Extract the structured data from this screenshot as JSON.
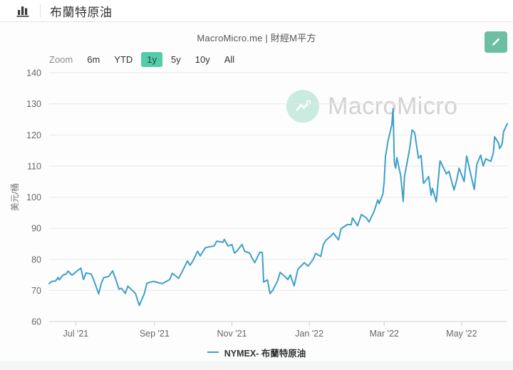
{
  "header": {
    "title": "布蘭特原油",
    "chart_icon": "bar-chart-icon"
  },
  "subheader": {
    "source": "MacroMicro.me | 財經M平方"
  },
  "toolbar": {
    "zoom_label": "Zoom",
    "ranges": [
      {
        "label": "6m",
        "active": false
      },
      {
        "label": "YTD",
        "active": false
      },
      {
        "label": "1y",
        "active": true
      },
      {
        "label": "5y",
        "active": false
      },
      {
        "label": "10y",
        "active": false
      },
      {
        "label": "All",
        "active": false
      }
    ]
  },
  "watermark": {
    "text": "MacroMicro"
  },
  "legend": {
    "series_label": "NYMEX- 布蘭特原油"
  },
  "colors": {
    "line": "#3fa0c8",
    "active_range_bg": "#54cba9",
    "edit_button_bg": "#6cbfa2",
    "grid": "#e8e8e8",
    "axis_line": "#d4d4d4",
    "tick": "#cccccc",
    "axis_label": "#666666",
    "watermark_circle": "#c9ebe0",
    "watermark_text": "#d2d2d2"
  },
  "chart_data": {
    "type": "line",
    "title": "布蘭特原油",
    "ylabel": "美元/桶",
    "ylim": [
      60,
      140
    ],
    "yticks": [
      60,
      70,
      80,
      90,
      100,
      110,
      120,
      130,
      140
    ],
    "grid": true,
    "legend_position": "bottom",
    "xticks": [
      {
        "date": "2021-07-01",
        "label": "Jul '21"
      },
      {
        "date": "2021-09-01",
        "label": "Sep '21"
      },
      {
        "date": "2021-11-01",
        "label": "Nov '21"
      },
      {
        "date": "2022-01-01",
        "label": "Jan '22"
      },
      {
        "date": "2022-03-01",
        "label": "Mar '22"
      },
      {
        "date": "2022-05-01",
        "label": "May '22"
      }
    ],
    "series": [
      {
        "name": "NYMEX- 布蘭特原油",
        "color": "#3fa0c8",
        "points": [
          [
            "2021-06-10",
            72.2
          ],
          [
            "2021-06-12",
            72.9
          ],
          [
            "2021-06-15",
            73.0
          ],
          [
            "2021-06-17",
            74.2
          ],
          [
            "2021-06-18",
            73.4
          ],
          [
            "2021-06-21",
            75.0
          ],
          [
            "2021-06-23",
            75.2
          ],
          [
            "2021-06-25",
            76.2
          ],
          [
            "2021-06-28",
            74.9
          ],
          [
            "2021-07-01",
            75.9
          ],
          [
            "2021-07-05",
            77.2
          ],
          [
            "2021-07-07",
            73.5
          ],
          [
            "2021-07-09",
            75.6
          ],
          [
            "2021-07-13",
            75.3
          ],
          [
            "2021-07-15",
            73.5
          ],
          [
            "2021-07-19",
            68.9
          ],
          [
            "2021-07-21",
            72.2
          ],
          [
            "2021-07-23",
            74.1
          ],
          [
            "2021-07-27",
            74.5
          ],
          [
            "2021-07-30",
            76.3
          ],
          [
            "2021-08-02",
            72.9
          ],
          [
            "2021-08-04",
            70.4
          ],
          [
            "2021-08-06",
            70.7
          ],
          [
            "2021-08-09",
            69.0
          ],
          [
            "2021-08-11",
            71.4
          ],
          [
            "2021-08-13",
            70.6
          ],
          [
            "2021-08-17",
            69.0
          ],
          [
            "2021-08-20",
            65.2
          ],
          [
            "2021-08-24",
            69.0
          ],
          [
            "2021-08-26",
            72.3
          ],
          [
            "2021-08-31",
            72.9
          ],
          [
            "2021-09-03",
            72.6
          ],
          [
            "2021-09-07",
            72.2
          ],
          [
            "2021-09-09",
            72.6
          ],
          [
            "2021-09-13",
            73.5
          ],
          [
            "2021-09-15",
            75.5
          ],
          [
            "2021-09-20",
            73.9
          ],
          [
            "2021-09-23",
            76.2
          ],
          [
            "2021-09-27",
            79.5
          ],
          [
            "2021-09-29",
            78.1
          ],
          [
            "2021-10-01",
            79.3
          ],
          [
            "2021-10-05",
            82.6
          ],
          [
            "2021-10-07",
            81.1
          ],
          [
            "2021-10-11",
            83.7
          ],
          [
            "2021-10-14",
            84.0
          ],
          [
            "2021-10-18",
            84.3
          ],
          [
            "2021-10-20",
            85.8
          ],
          [
            "2021-10-25",
            85.5
          ],
          [
            "2021-10-26",
            86.4
          ],
          [
            "2021-10-29",
            84.3
          ],
          [
            "2021-11-01",
            84.7
          ],
          [
            "2021-11-03",
            82.0
          ],
          [
            "2021-11-05",
            82.7
          ],
          [
            "2021-11-09",
            84.8
          ],
          [
            "2021-11-11",
            82.6
          ],
          [
            "2021-11-15",
            82.0
          ],
          [
            "2021-11-17",
            80.3
          ],
          [
            "2021-11-19",
            78.9
          ],
          [
            "2021-11-23",
            82.3
          ],
          [
            "2021-11-25",
            82.2
          ],
          [
            "2021-11-26",
            72.7
          ],
          [
            "2021-11-29",
            73.4
          ],
          [
            "2021-12-01",
            69.0
          ],
          [
            "2021-12-03",
            69.9
          ],
          [
            "2021-12-07",
            73.1
          ],
          [
            "2021-12-09",
            75.8
          ],
          [
            "2021-12-13",
            74.4
          ],
          [
            "2021-12-15",
            73.5
          ],
          [
            "2021-12-17",
            75.0
          ],
          [
            "2021-12-20",
            71.5
          ],
          [
            "2021-12-23",
            76.8
          ],
          [
            "2021-12-28",
            78.9
          ],
          [
            "2021-12-31",
            77.8
          ],
          [
            "2022-01-04",
            80.0
          ],
          [
            "2022-01-06",
            81.9
          ],
          [
            "2022-01-10",
            80.9
          ],
          [
            "2022-01-12",
            84.7
          ],
          [
            "2022-01-14",
            86.1
          ],
          [
            "2022-01-18",
            87.5
          ],
          [
            "2022-01-20",
            88.4
          ],
          [
            "2022-01-24",
            86.3
          ],
          [
            "2022-01-26",
            89.9
          ],
          [
            "2022-01-31",
            91.2
          ],
          [
            "2022-02-03",
            91.1
          ],
          [
            "2022-02-04",
            93.3
          ],
          [
            "2022-02-08",
            90.8
          ],
          [
            "2022-02-11",
            94.4
          ],
          [
            "2022-02-15",
            93.3
          ],
          [
            "2022-02-17",
            92.0
          ],
          [
            "2022-02-21",
            95.4
          ],
          [
            "2022-02-24",
            99.1
          ],
          [
            "2022-02-25",
            97.9
          ],
          [
            "2022-02-28",
            101.0
          ],
          [
            "2022-03-01",
            105.0
          ],
          [
            "2022-03-02",
            113.0
          ],
          [
            "2022-03-04",
            118.1
          ],
          [
            "2022-03-07",
            123.2
          ],
          [
            "2022-03-08",
            128.5
          ],
          [
            "2022-03-09",
            111.1
          ],
          [
            "2022-03-10",
            109.3
          ],
          [
            "2022-03-11",
            112.7
          ],
          [
            "2022-03-14",
            106.9
          ],
          [
            "2022-03-16",
            98.6
          ],
          [
            "2022-03-17",
            106.6
          ],
          [
            "2022-03-21",
            115.5
          ],
          [
            "2022-03-23",
            121.6
          ],
          [
            "2022-03-25",
            120.7
          ],
          [
            "2022-03-28",
            112.5
          ],
          [
            "2022-03-30",
            113.4
          ],
          [
            "2022-04-01",
            104.4
          ],
          [
            "2022-04-05",
            106.6
          ],
          [
            "2022-04-07",
            100.6
          ],
          [
            "2022-04-08",
            102.8
          ],
          [
            "2022-04-11",
            98.5
          ],
          [
            "2022-04-14",
            111.7
          ],
          [
            "2022-04-19",
            107.5
          ],
          [
            "2022-04-21",
            108.3
          ],
          [
            "2022-04-25",
            102.3
          ],
          [
            "2022-04-27",
            105.3
          ],
          [
            "2022-04-29",
            109.3
          ],
          [
            "2022-05-03",
            105.0
          ],
          [
            "2022-05-05",
            113.2
          ],
          [
            "2022-05-09",
            105.9
          ],
          [
            "2022-05-11",
            102.5
          ],
          [
            "2022-05-13",
            110.6
          ],
          [
            "2022-05-16",
            113.5
          ],
          [
            "2022-05-18",
            110.0
          ],
          [
            "2022-05-20",
            112.3
          ],
          [
            "2022-05-24",
            111.5
          ],
          [
            "2022-05-26",
            114.2
          ],
          [
            "2022-05-27",
            119.4
          ],
          [
            "2022-05-30",
            117.5
          ],
          [
            "2022-05-31",
            115.6
          ],
          [
            "2022-06-01",
            116.3
          ],
          [
            "2022-06-02",
            117.3
          ],
          [
            "2022-06-03",
            121.0
          ],
          [
            "2022-06-06",
            123.6
          ]
        ]
      }
    ]
  }
}
